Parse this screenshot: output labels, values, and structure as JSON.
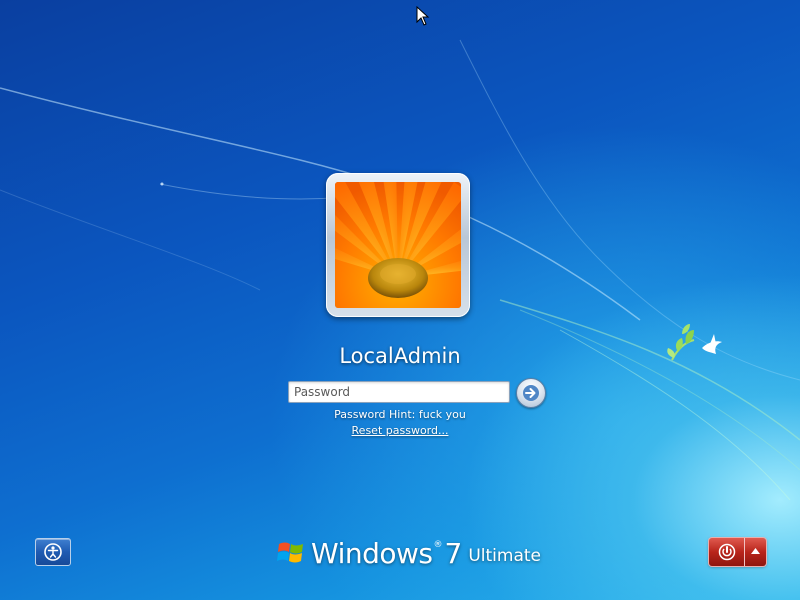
{
  "user": {
    "name": "LocalAdmin",
    "picture_icon": "orange-daisy-user-picture"
  },
  "login": {
    "password_placeholder": "Password",
    "password_value": "",
    "submit_icon": "arrow-right-icon",
    "password_hint": "Password Hint: fuck you",
    "reset_password_label": "Reset password..."
  },
  "footer": {
    "ease_of_access_icon": "ease-of-access-icon",
    "brand_windows": "Windows",
    "brand_reg": "®",
    "brand_version": "7",
    "brand_edition": "Ultimate",
    "shutdown_icon": "power-icon",
    "shutdown_options_icon": "chevron-up-icon"
  },
  "colors": {
    "background_dark": "#0a3fa0",
    "background_light": "#2bb6ec",
    "shutdown_red": "#b8251b",
    "ease_button_blue": "#1f5bb2"
  }
}
